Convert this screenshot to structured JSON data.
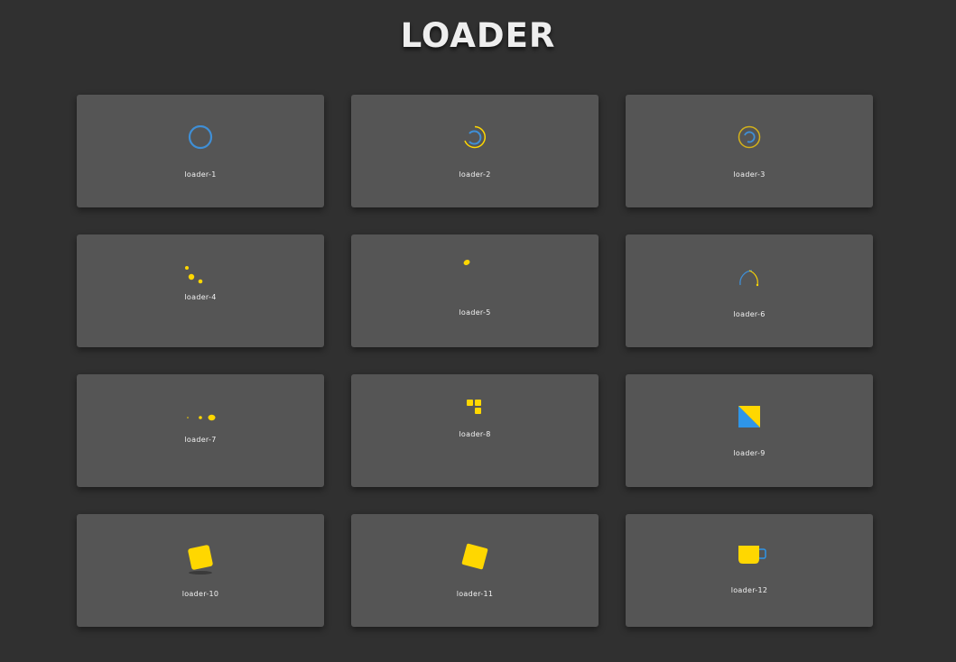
{
  "page": {
    "title": "LOADER",
    "background_color": "#303030"
  },
  "colors": {
    "card": "#555555",
    "accent_yellow": "#FFD700",
    "accent_blue": "#3F8FD6",
    "label": "#F2F2F2"
  },
  "cards": [
    {
      "label": "loader-1",
      "icon": "spinning-ring-icon"
    },
    {
      "label": "loader-2",
      "icon": "double-arc-spinner-icon"
    },
    {
      "label": "loader-3",
      "icon": "nested-ring-spinner-icon"
    },
    {
      "label": "loader-4",
      "icon": "bouncing-dots-icon"
    },
    {
      "label": "loader-5",
      "icon": "orbiting-dot-icon"
    },
    {
      "label": "loader-6",
      "icon": "arc-sweep-icon"
    },
    {
      "label": "loader-7",
      "icon": "growing-dots-icon"
    },
    {
      "label": "loader-8",
      "icon": "square-grid-icon"
    },
    {
      "label": "loader-9",
      "icon": "flipping-square-icon"
    },
    {
      "label": "loader-10",
      "icon": "bouncing-square-shadow-icon"
    },
    {
      "label": "loader-11",
      "icon": "rotating-square-icon"
    },
    {
      "label": "loader-12",
      "icon": "coffee-cup-icon"
    }
  ]
}
